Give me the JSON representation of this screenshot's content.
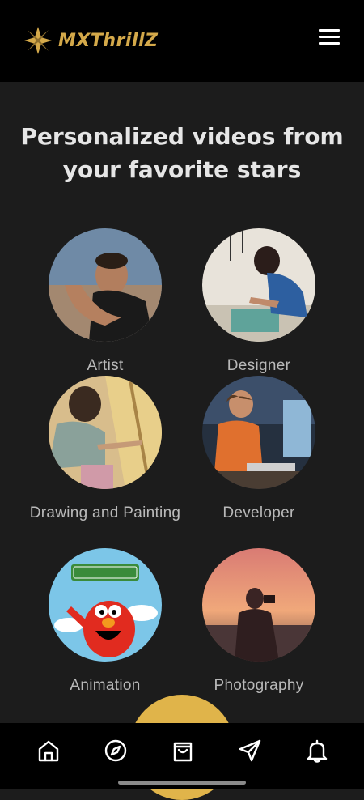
{
  "header": {
    "brand": "MXThrillZ",
    "brand_color": "#d4a94a",
    "menu_icon": "hamburger-menu-icon"
  },
  "main": {
    "headline": "Personalized videos from your favorite stars",
    "categories": [
      {
        "label": "Artist",
        "image": "man-gesturing-photo"
      },
      {
        "label": "Designer",
        "image": "woman-drawing-at-desk-photo"
      },
      {
        "label": "Drawing and Painting",
        "image": "woman-painting-canvas-photo"
      },
      {
        "label": "Developer",
        "image": "man-coding-at-computer-photo"
      },
      {
        "label": "Animation",
        "image": "sesame-street-elmo-image"
      },
      {
        "label": "Photography",
        "image": "photographer-silhouette-sunset-photo"
      }
    ]
  },
  "bottom_nav": {
    "items": [
      "home-icon",
      "compass-icon",
      "shopping-bag-icon",
      "send-icon",
      "bell-icon"
    ]
  },
  "colors": {
    "background": "#1c1c1c",
    "bars": "#000000",
    "accent": "#e0b44a"
  }
}
